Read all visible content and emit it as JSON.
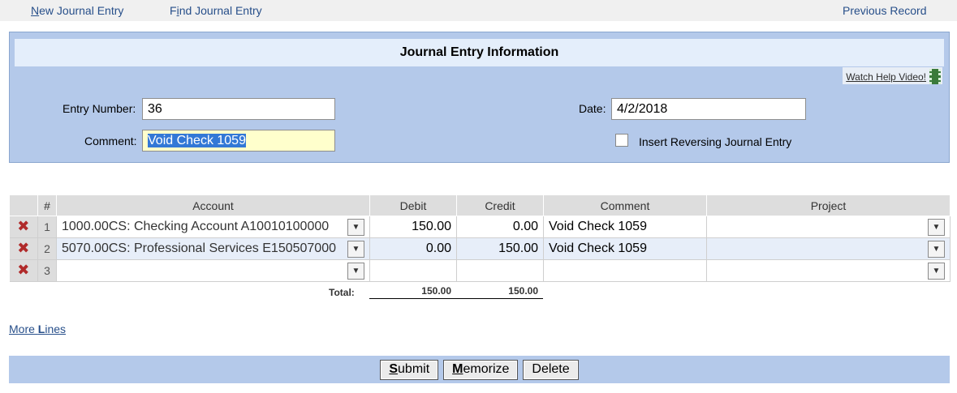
{
  "nav": {
    "new_entry": {
      "u": "N",
      "rest": "ew Journal Entry"
    },
    "find_entry": {
      "pre": "F",
      "u": "i",
      "rest": "nd Journal Entry"
    },
    "previous_record": "Previous Record"
  },
  "info": {
    "title": "Journal Entry Information",
    "help_video": "Watch Help Video!",
    "entry_number_label": "Entry Number:",
    "entry_number": "36",
    "comment_label": "Comment:",
    "comment": "Void Check 1059",
    "date_label": "Date:",
    "date": "4/2/2018",
    "reversing_label": "Insert Reversing Journal Entry"
  },
  "grid": {
    "headers": {
      "num": "#",
      "account": "Account",
      "debit": "Debit",
      "credit": "Credit",
      "comment": "Comment",
      "project": "Project"
    },
    "rows": [
      {
        "num": "1",
        "account": "1000.00CS: Checking Account A10010100000",
        "debit": "150.00",
        "credit": "0.00",
        "comment": "Void Check 1059",
        "project": ""
      },
      {
        "num": "2",
        "account": "5070.00CS: Professional Services E150507000",
        "debit": "0.00",
        "credit": "150.00",
        "comment": "Void Check 1059",
        "project": ""
      },
      {
        "num": "3",
        "account": "",
        "debit": "",
        "credit": "",
        "comment": "",
        "project": ""
      }
    ],
    "total_label": "Total:",
    "total_debit": "150.00",
    "total_credit": "150.00"
  },
  "more_lines": {
    "pre": "More ",
    "u": "L",
    "rest": "ines"
  },
  "buttons": {
    "submit": {
      "u": "S",
      "rest": "ubmit"
    },
    "memorize": {
      "u": "M",
      "rest": "emorize"
    },
    "delete": "Delete"
  },
  "colors": {
    "panel": "#b4c9ea",
    "title_band": "#e4eefb",
    "link": "#274f8a",
    "delete_icon": "#b02a2a",
    "alt_row": "#e7eef9"
  }
}
